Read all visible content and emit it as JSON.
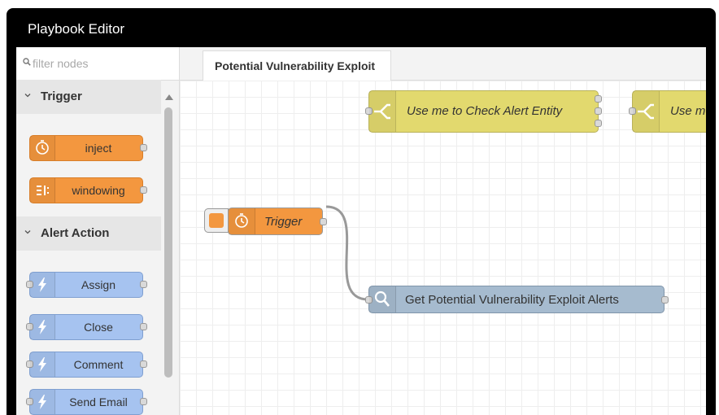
{
  "window": {
    "title": "Playbook Editor"
  },
  "palette": {
    "filter_placeholder": "filter nodes",
    "categories": [
      {
        "label": "Trigger",
        "nodes": [
          {
            "label": "inject",
            "icon": "timer-icon"
          },
          {
            "label": "windowing",
            "icon": "windowing-icon"
          }
        ]
      },
      {
        "label": "Alert Action",
        "nodes": [
          {
            "label": "Assign",
            "icon": "lightning-icon"
          },
          {
            "label": "Close",
            "icon": "lightning-icon"
          },
          {
            "label": "Comment",
            "icon": "lightning-icon"
          },
          {
            "label": "Send Email",
            "icon": "lightning-icon"
          }
        ]
      }
    ]
  },
  "workspace": {
    "tab_label": "Potential Vulnerability Exploit",
    "nodes": {
      "switch1": "Use me to Check Alert Entity",
      "switch2": "Use me",
      "trigger": "Trigger",
      "query": "Get Potential Vulnerability Exploit Alerts"
    }
  },
  "colors": {
    "trigger_node": "#f3973f",
    "alert_action_node": "#a6c3f0",
    "switch_node": "#e2d96e",
    "query_node": "#a6bbcf",
    "title_bar": "#000000"
  }
}
